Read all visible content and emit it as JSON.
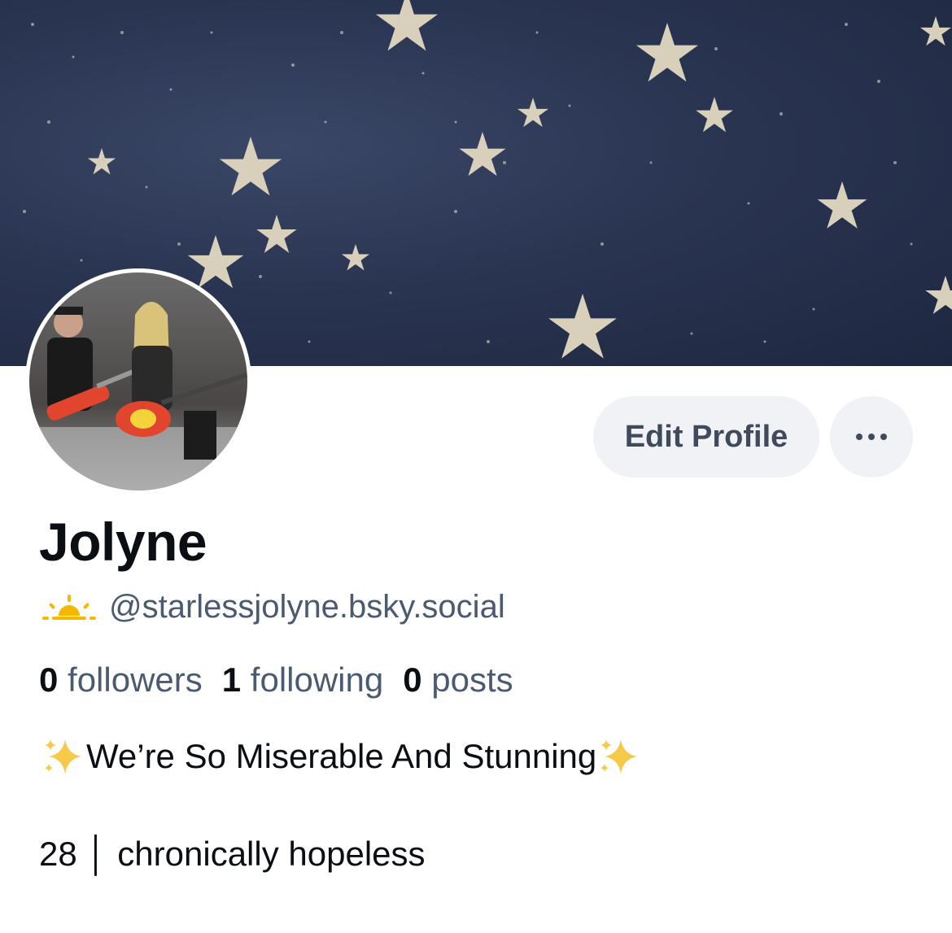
{
  "profile": {
    "display_name": "Jolyne",
    "handle": "@starlessjolyne.bsky.social",
    "handle_icon": "sun-horizon-icon",
    "stats": [
      {
        "count": "0",
        "label": "followers"
      },
      {
        "count": "1",
        "label": "following"
      },
      {
        "count": "0",
        "label": "posts"
      }
    ],
    "bio_line1": "We’re So Miserable And Stunning",
    "bio_line2": "28 │ chronically hopeless"
  },
  "actions": {
    "edit_label": "Edit Profile",
    "more_icon": "ellipsis-icon"
  },
  "colors": {
    "banner": "#2a3552",
    "button_bg": "#f0f2f5",
    "button_text": "#3f4a5c",
    "muted_text": "#4a5a70",
    "sun": "#f5b800"
  }
}
